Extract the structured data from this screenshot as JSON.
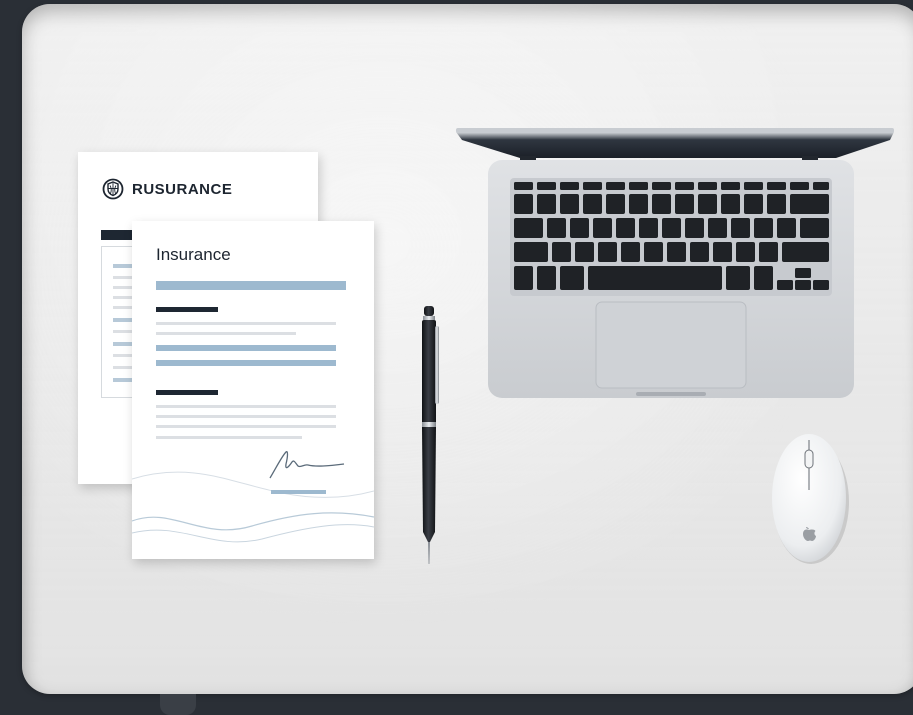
{
  "scene": {
    "documents": {
      "back_sheet": {
        "brand_name": "RUSURANCE",
        "logo_icon": "shield-globe-icon"
      },
      "front_sheet": {
        "title": "Insurance",
        "signature_icon": "signature-icon"
      }
    },
    "objects": [
      "pen",
      "laptop",
      "mouse"
    ],
    "mouse_logo_icon": "apple-icon"
  },
  "colors": {
    "desk": "#ececec",
    "background": "#2a2f36",
    "accent_blue": "#9db9cf",
    "dark_text": "#1d2530",
    "laptop_silver": "#d4d6d9",
    "keyboard_key": "#1f2226"
  }
}
